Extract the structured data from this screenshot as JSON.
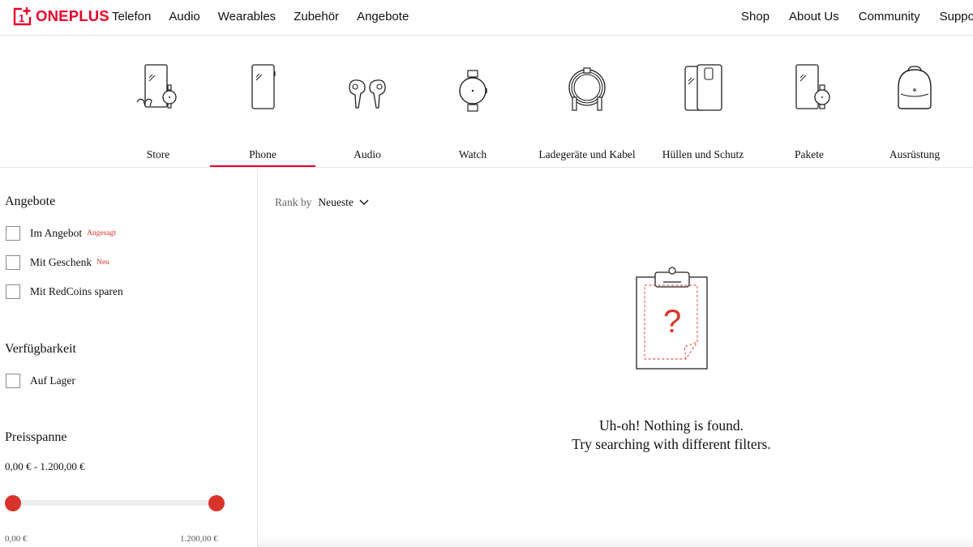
{
  "brand": {
    "name": "ONEPLUS",
    "mark": "1",
    "color": "#eb0029"
  },
  "nav": {
    "left": [
      "Telefon",
      "Audio",
      "Wearables",
      "Zubehör",
      "Angebote"
    ],
    "right": [
      "Shop",
      "About Us",
      "Community",
      "Support"
    ]
  },
  "categories": [
    {
      "label": "Store",
      "icon": "store-icon"
    },
    {
      "label": "Phone",
      "icon": "phone-icon",
      "active": true
    },
    {
      "label": "Audio",
      "icon": "earbuds-icon"
    },
    {
      "label": "Watch",
      "icon": "watch-icon"
    },
    {
      "label": "Ladegeräte und Kabel",
      "icon": "cable-icon"
    },
    {
      "label": "Hüllen und Schutz",
      "icon": "case-icon"
    },
    {
      "label": "Pakete",
      "icon": "bundle-icon"
    },
    {
      "label": "Ausrüstung",
      "icon": "backpack-icon"
    }
  ],
  "filters": {
    "offers": {
      "title": "Angebote",
      "items": [
        {
          "label": "Im Angebot",
          "tag": "Angesagt"
        },
        {
          "label": "Mit Geschenk",
          "tag": "Neu"
        },
        {
          "label": "Mit RedCoins sparen",
          "tag": ""
        }
      ]
    },
    "availability": {
      "title": "Verfügbarkeit",
      "items": [
        {
          "label": "Auf Lager"
        }
      ]
    },
    "price": {
      "title": "Preisspanne",
      "range_text": "0,00 € - 1.200,00 €",
      "min_label": "0,00 €",
      "max_label": "1.200,00 €",
      "min_value": 0,
      "max_value": 1200,
      "selected_min": 0,
      "selected_max": 1200
    }
  },
  "sort": {
    "label": "Rank by",
    "value": "Neueste"
  },
  "empty": {
    "symbol": "?",
    "line1": "Uh-oh! Nothing is found.",
    "line2": "Try searching with different filters."
  },
  "colors": {
    "accent": "#d9342b",
    "text": "#111111",
    "muted": "#666666",
    "divider": "#e6e6e6"
  }
}
